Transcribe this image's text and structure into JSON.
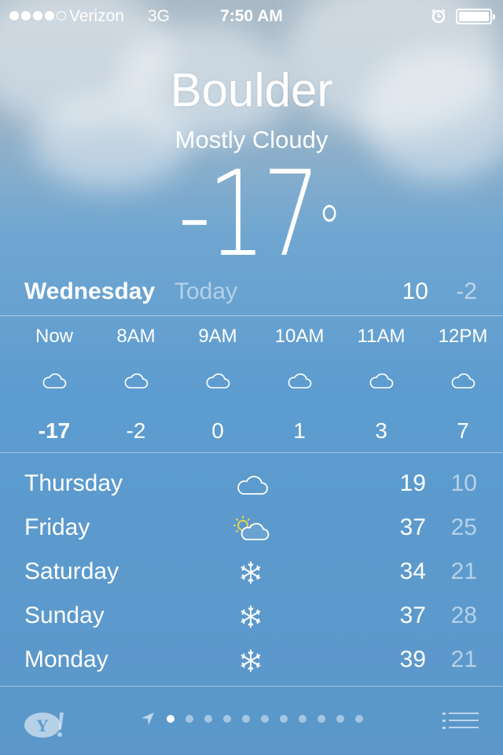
{
  "status": {
    "carrier": "Verizon",
    "network": "3G",
    "time": "7:50 AM",
    "signal_bars_filled": 4,
    "signal_bars_total": 5,
    "battery_level": 1.0
  },
  "location": {
    "city": "Boulder",
    "condition": "Mostly Cloudy",
    "temperature": "-17",
    "unit": "°"
  },
  "today": {
    "day": "Wednesday",
    "label": "Today",
    "high": "10",
    "low": "-2"
  },
  "hourly": [
    {
      "time": "Now",
      "icon": "cloud-icon",
      "temp": "-17"
    },
    {
      "time": "8AM",
      "icon": "cloud-icon",
      "temp": "-2"
    },
    {
      "time": "9AM",
      "icon": "cloud-icon",
      "temp": "0"
    },
    {
      "time": "10AM",
      "icon": "cloud-icon",
      "temp": "1"
    },
    {
      "time": "11AM",
      "icon": "cloud-icon",
      "temp": "3"
    },
    {
      "time": "12PM",
      "icon": "cloud-icon",
      "temp": "7"
    }
  ],
  "daily": [
    {
      "day": "Thursday",
      "icon": "cloud-icon",
      "high": "19",
      "low": "10"
    },
    {
      "day": "Friday",
      "icon": "partly-sunny-icon",
      "high": "37",
      "low": "25"
    },
    {
      "day": "Saturday",
      "icon": "snowflake-icon",
      "high": "34",
      "low": "21"
    },
    {
      "day": "Sunday",
      "icon": "snowflake-icon",
      "high": "37",
      "low": "28"
    },
    {
      "day": "Monday",
      "icon": "snowflake-icon",
      "high": "39",
      "low": "21"
    }
  ],
  "footer": {
    "page_count": 11,
    "active_page": 0
  },
  "colors": {
    "sun": "#f5d742",
    "text": "#ffffff",
    "background_top": "#a9b9c6",
    "background_bottom": "#5b97c9"
  }
}
